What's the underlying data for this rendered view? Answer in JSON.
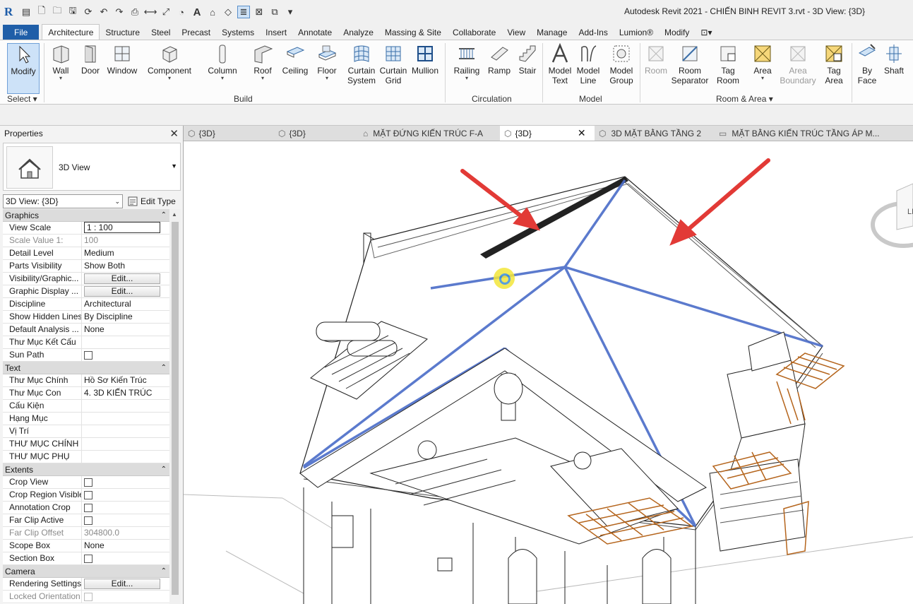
{
  "window_title": "Autodesk Revit 2021 - CHIẾN BINH REVIT 3.rvt - 3D View: {3D}",
  "app_logo": "R",
  "ribbon_tabs": [
    "File",
    "Architecture",
    "Structure",
    "Steel",
    "Precast",
    "Systems",
    "Insert",
    "Annotate",
    "Analyze",
    "Massing & Site",
    "Collaborate",
    "View",
    "Manage",
    "Add-Ins",
    "Lumion®",
    "Modify"
  ],
  "ribbon_tab_active": "Architecture",
  "ribbon": {
    "select": {
      "modify": "Modify",
      "label": "Select ▾"
    },
    "build": {
      "label": "Build",
      "wall": "Wall",
      "door": "Door",
      "window": "Window",
      "component": "Component",
      "column": "Column",
      "roof": "Roof",
      "ceiling": "Ceiling",
      "floor": "Floor",
      "curtain_system": [
        "Curtain",
        "System"
      ],
      "curtain_grid": [
        "Curtain",
        "Grid"
      ],
      "mullion": "Mullion"
    },
    "circulation": {
      "label": "Circulation",
      "railing": "Railing",
      "ramp": "Ramp",
      "stair": "Stair"
    },
    "model": {
      "label": "Model",
      "model_text": [
        "Model",
        "Text"
      ],
      "model_line": [
        "Model",
        "Line"
      ],
      "model_group": [
        "Model",
        "Group"
      ]
    },
    "room_area": {
      "label": "Room & Area ▾",
      "room": "Room",
      "room_separator": [
        "Room",
        "Separator"
      ],
      "tag_room": [
        "Tag",
        "Room"
      ],
      "area": "Area",
      "area_boundary": [
        "Area",
        "Boundary"
      ],
      "tag_area": [
        "Tag",
        "Area"
      ]
    },
    "opening": {
      "by_face": [
        "By",
        "Face"
      ],
      "shaft": "Shaft"
    }
  },
  "properties": {
    "title": "Properties",
    "type_name": "3D View",
    "instance": "3D View: {3D}",
    "edit_type": "Edit Type",
    "groups": [
      {
        "name": "Graphics",
        "rows": [
          {
            "name": "View Scale",
            "value": "1 : 100",
            "kind": "input"
          },
          {
            "name": "Scale Value    1:",
            "value": "100",
            "ro": true
          },
          {
            "name": "Detail Level",
            "value": "Medium"
          },
          {
            "name": "Parts Visibility",
            "value": "Show Both"
          },
          {
            "name": "Visibility/Graphic...",
            "value": "Edit...",
            "kind": "button"
          },
          {
            "name": "Graphic Display ...",
            "value": "Edit...",
            "kind": "button"
          },
          {
            "name": "Discipline",
            "value": "Architectural"
          },
          {
            "name": "Show Hidden Lines",
            "value": "By Discipline"
          },
          {
            "name": "Default Analysis ...",
            "value": "None"
          },
          {
            "name": "Thư Mục Kết Cấu",
            "value": ""
          },
          {
            "name": "Sun Path",
            "value": "",
            "kind": "check"
          }
        ]
      },
      {
        "name": "Text",
        "rows": [
          {
            "name": "Thư Mục Chính",
            "value": "Hồ Sơ Kiến Trúc"
          },
          {
            "name": "Thư Mục Con",
            "value": "4. 3D KIẾN TRÚC"
          },
          {
            "name": "Cấu Kiện",
            "value": ""
          },
          {
            "name": "Hạng Mục",
            "value": ""
          },
          {
            "name": "Vị Trí",
            "value": ""
          },
          {
            "name": "THƯ MỤC CHÍNH",
            "value": ""
          },
          {
            "name": "THƯ MỤC PHỤ",
            "value": ""
          }
        ]
      },
      {
        "name": "Extents",
        "rows": [
          {
            "name": "Crop View",
            "value": "",
            "kind": "check"
          },
          {
            "name": "Crop Region Visible",
            "value": "",
            "kind": "check"
          },
          {
            "name": "Annotation Crop",
            "value": "",
            "kind": "check"
          },
          {
            "name": "Far Clip Active",
            "value": "",
            "kind": "check"
          },
          {
            "name": "Far Clip Offset",
            "value": "304800.0",
            "ro": true
          },
          {
            "name": "Scope Box",
            "value": "None"
          },
          {
            "name": "Section Box",
            "value": "",
            "kind": "check"
          }
        ]
      },
      {
        "name": "Camera",
        "rows": [
          {
            "name": "Rendering Settings",
            "value": "Edit...",
            "kind": "button"
          },
          {
            "name": "Locked Orientation",
            "value": "",
            "kind": "check",
            "ro": true
          }
        ]
      }
    ]
  },
  "view_tabs": [
    {
      "label": "{3D}",
      "icon": "3d-view-icon"
    },
    {
      "label": "{3D}",
      "icon": "3d-view-icon"
    },
    {
      "label": "MẶT ĐỨNG KIẾN TRÚC F-A",
      "icon": "elevation-icon"
    },
    {
      "label": "{3D}",
      "icon": "3d-view-icon",
      "active": true
    },
    {
      "label": "3D MẶT BẰNG TẦNG 2",
      "icon": "3d-view-icon"
    },
    {
      "label": "MẶT BẰNG KIẾN TRÚC TẦNG ÁP M...",
      "icon": "floor-plan-icon"
    }
  ],
  "colors": {
    "file_tab": "#1f5ea8",
    "roof_edges": "#4a6cc8",
    "arrow": "#e23a36",
    "trellis": "#b5651d",
    "cursor": "#f3e63a"
  },
  "viewcube_label": "LE"
}
